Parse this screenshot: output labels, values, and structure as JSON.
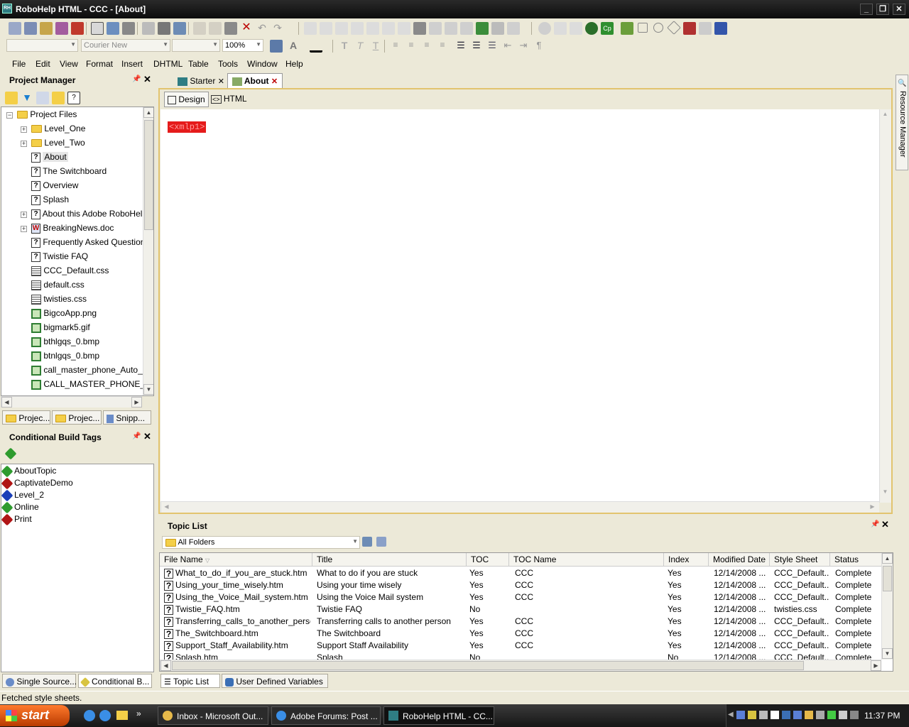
{
  "window": {
    "title": "RoboHelp HTML - CCC - [About]",
    "app_icon": "RH"
  },
  "toolbar": {
    "font": "Courier New",
    "zoom": "100%"
  },
  "menu": [
    "File",
    "Edit",
    "View",
    "Format",
    "Insert",
    "DHTML",
    "Table",
    "Tools",
    "Window",
    "Help"
  ],
  "project_manager": {
    "title": "Project Manager",
    "tree_root": "Project Files",
    "items": [
      {
        "label": "Level_One",
        "icon": "folder-icon"
      },
      {
        "label": "Level_Two",
        "icon": "folder-icon"
      },
      {
        "label": "About",
        "icon": "topic-icon"
      },
      {
        "label": "The Switchboard",
        "icon": "topic-icon"
      },
      {
        "label": "Overview",
        "icon": "topic-icon"
      },
      {
        "label": "Splash",
        "icon": "topic-icon"
      },
      {
        "label": "About this Adobe RoboHelp",
        "icon": "topic-icon"
      },
      {
        "label": "BreakingNews.doc",
        "icon": "word-doc-icon"
      },
      {
        "label": "Frequently Asked Questions",
        "icon": "topic-icon"
      },
      {
        "label": "Twistie FAQ",
        "icon": "topic-icon"
      },
      {
        "label": "CCC_Default.css",
        "icon": "css-icon"
      },
      {
        "label": "default.css",
        "icon": "css-icon"
      },
      {
        "label": "twisties.css",
        "icon": "css-icon"
      },
      {
        "label": "BigcoApp.png",
        "icon": "image-icon"
      },
      {
        "label": "bigmark5.gif",
        "icon": "image-icon"
      },
      {
        "label": "bthlgqs_0.bmp",
        "icon": "image-icon"
      },
      {
        "label": "btnlgqs_0.bmp",
        "icon": "image-icon"
      },
      {
        "label": "call_master_phone_Auto_In...",
        "icon": "image-icon"
      },
      {
        "label": "CALL_MASTER_PHONE_h...",
        "icon": "image-icon"
      }
    ],
    "bottom_tabs": [
      "Projec...",
      "Projec...",
      "Snipp..."
    ]
  },
  "conditional_build_tags": {
    "title": "Conditional Build Tags",
    "tags": [
      {
        "label": "AboutTopic",
        "color": "#2e9b2e"
      },
      {
        "label": "CaptivateDemo",
        "color": "#b01515"
      },
      {
        "label": "Level_2",
        "color": "#1a3fb8"
      },
      {
        "label": "Online",
        "color": "#2e9b2e"
      },
      {
        "label": "Print",
        "color": "#b01515"
      }
    ],
    "bottom_tabs": [
      "Single Source...",
      "Conditional B..."
    ]
  },
  "editor": {
    "tabs": [
      {
        "label": "Starter"
      },
      {
        "label": "About"
      }
    ],
    "view_tabs": [
      "Design",
      "HTML"
    ],
    "content_marker": "<xmlp1>"
  },
  "resource_manager": {
    "label": "Resource Manager"
  },
  "topic_list": {
    "title": "Topic List",
    "folder_filter": "All Folders",
    "columns": [
      "File Name",
      "Title",
      "TOC",
      "TOC Name",
      "Index",
      "Modified Date",
      "Style Sheet",
      "Status"
    ],
    "rows": [
      [
        "What_to_do_if_you_are_stuck.htm",
        "What to do if you are stuck",
        "Yes",
        "CCC",
        "Yes",
        "12/14/2008 ...",
        "CCC_Default....",
        "Complete"
      ],
      [
        "Using_your_time_wisely.htm",
        "Using your time wisely",
        "Yes",
        "CCC",
        "Yes",
        "12/14/2008 ...",
        "CCC_Default....",
        "Complete"
      ],
      [
        "Using_the_Voice_Mail_system.htm",
        "Using the Voice Mail system",
        "Yes",
        "CCC",
        "Yes",
        "12/14/2008 ...",
        "CCC_Default....",
        "Complete"
      ],
      [
        "Twistie_FAQ.htm",
        "Twistie FAQ",
        "No",
        "",
        "Yes",
        "12/14/2008 ...",
        "twisties.css",
        "Complete"
      ],
      [
        "Transferring_calls_to_another_person....",
        "Transferring calls to another person",
        "Yes",
        "CCC",
        "Yes",
        "12/14/2008 ...",
        "CCC_Default....",
        "Complete"
      ],
      [
        "The_Switchboard.htm",
        "The Switchboard",
        "Yes",
        "CCC",
        "Yes",
        "12/14/2008 ...",
        "CCC_Default....",
        "Complete"
      ],
      [
        "Support_Staff_Availability.htm",
        "Support Staff Availability",
        "Yes",
        "CCC",
        "Yes",
        "12/14/2008 ...",
        "CCC_Default....",
        "Complete"
      ],
      [
        "Splash.htm",
        "Splash",
        "No",
        "",
        "No",
        "12/14/2008 ...",
        "CCC_Default....",
        "Complete"
      ]
    ],
    "bottom_tabs": [
      "Topic List",
      "User Defined Variables"
    ]
  },
  "status_bar": "Fetched style sheets.",
  "taskbar": {
    "start": "start",
    "tasks": [
      "Inbox - Microsoft Out...",
      "Adobe Forums: Post ...",
      "RoboHelp HTML - CC..."
    ],
    "clock": "11:37 PM"
  }
}
